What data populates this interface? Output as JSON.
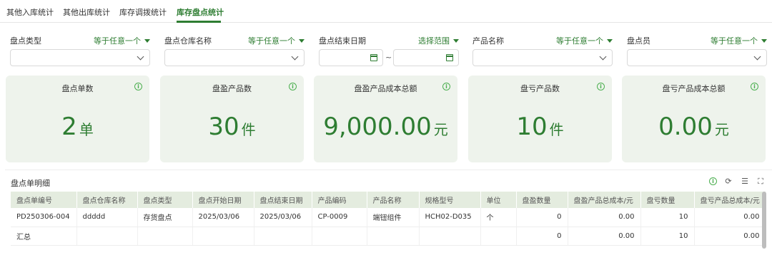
{
  "tabs": [
    {
      "label": "其他入库统计",
      "active": false
    },
    {
      "label": "其他出库统计",
      "active": false
    },
    {
      "label": "库存调拨统计",
      "active": false
    },
    {
      "label": "库存盘点统计",
      "active": true
    }
  ],
  "filters": {
    "type": {
      "label": "盘点类型",
      "operator": "等于任意一个",
      "value": ""
    },
    "warehouse": {
      "label": "盘点仓库名称",
      "operator": "等于任意一个",
      "value": ""
    },
    "end_date": {
      "label": "盘点结束日期",
      "operator": "选择范围",
      "separator": "~",
      "start": "",
      "end": ""
    },
    "product": {
      "label": "产品名称",
      "operator": "等于任意一个",
      "value": ""
    },
    "staff": {
      "label": "盘点员",
      "operator": "等于任意一个",
      "value": ""
    }
  },
  "cards": [
    {
      "title": "盘点单数",
      "value": "2",
      "unit": "单"
    },
    {
      "title": "盘盈产品数",
      "value": "30",
      "unit": "件"
    },
    {
      "title": "盘盈产品成本总额",
      "value": "9,000.00",
      "unit": "元"
    },
    {
      "title": "盘亏产品数",
      "value": "10",
      "unit": "件"
    },
    {
      "title": "盘亏产品成本总额",
      "value": "0.00",
      "unit": "元"
    }
  ],
  "detail": {
    "title": "盘点单明细",
    "columns": [
      "盘点单编号",
      "盘点仓库名称",
      "盘点类型",
      "盘点开始日期",
      "盘点结束日期",
      "产品编码",
      "产品名称",
      "规格型号",
      "单位",
      "盘盈数量",
      "盘盈产品总成本/元",
      "盘亏数量",
      "盘亏产品总成本/元"
    ],
    "rows": [
      [
        "PD250306-004",
        "ddddd",
        "存货盘点",
        "2025/03/06",
        "2025/03/06",
        "CP-0009",
        "端钮组件",
        "HCH02-D035",
        "个",
        "0",
        "0.00",
        "10",
        "0.00"
      ]
    ],
    "summary": {
      "label": "汇总",
      "gain_qty": "0",
      "gain_cost": "0.00",
      "loss_qty": "10",
      "loss_cost": "0.00"
    }
  },
  "icons": {
    "info": "info-circle-icon",
    "refresh": "refresh-icon",
    "column_settings": "column-settings-icon",
    "fullscreen": "fullscreen-icon"
  },
  "colors": {
    "accent": "#2e7d32",
    "card_bg": "#eef3ec",
    "header_bg": "#e4ecdf"
  }
}
